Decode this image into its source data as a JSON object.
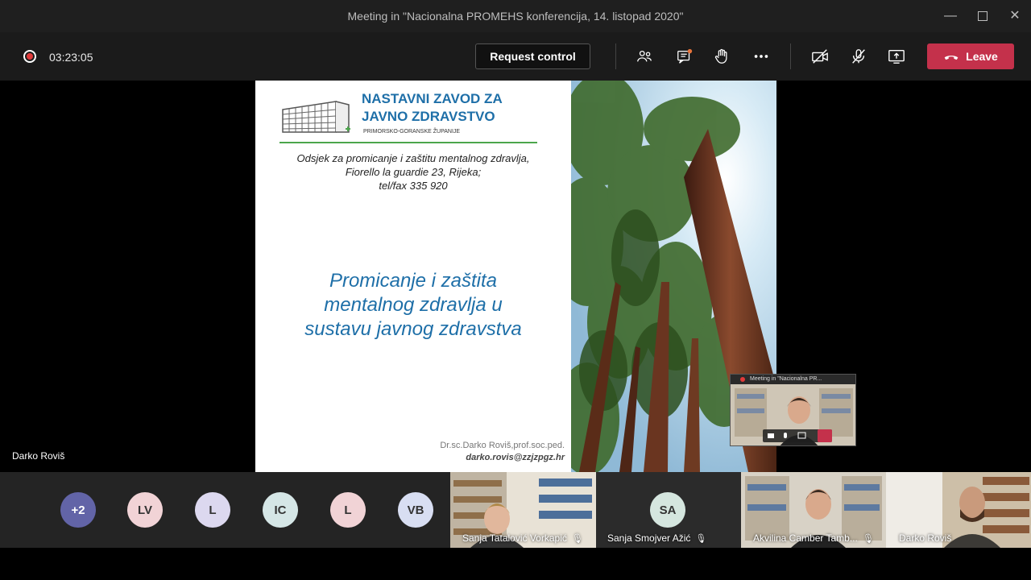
{
  "window": {
    "title": "Meeting in \"Nacionalna PROMEHS konferencija, 14. listopad 2020\""
  },
  "toolbar": {
    "timer": "03:23:05",
    "request_control_label": "Request control",
    "leave_label": "Leave",
    "icons": [
      "participants-icon",
      "chat-icon",
      "raise-hand-icon",
      "more-options-icon",
      "camera-off-icon",
      "mic-off-icon",
      "share-screen-icon"
    ]
  },
  "slide": {
    "org_line1": "NASTAVNI ZAVOD ZA",
    "org_line2": "JAVNO ZDRAVSTVO",
    "org_sub": "PRIMORSKO-GORANSKE ŽUPANIJE",
    "address_line1": "Odsjek za promicanje i zaštitu mentalnog zdravlja,",
    "address_line2": "Fiorello la guardie 23, Rijeka;",
    "address_line3": "tel/fax 335 920",
    "title_line1": "Promicanje i zaštita",
    "title_line2": "mentalnog zdravlja u",
    "title_line3": "sustavu javnog zdravstva",
    "author": "Dr.sc.Darko Roviš,prof.soc.ped.",
    "email": "darko.rovis@zzjzpgz.hr"
  },
  "mini_preview": {
    "title": "Meeting in \"Nacionalna PR..."
  },
  "presenter": {
    "name": "Darko Roviš"
  },
  "participants": {
    "avatars": [
      {
        "initials": "+2",
        "color": "#6264a7",
        "text_color": "#ffffff"
      },
      {
        "initials": "LV",
        "color": "#f1d3d6"
      },
      {
        "initials": "L",
        "color": "#dcd8ef"
      },
      {
        "initials": "IC",
        "color": "#d5e6e6"
      },
      {
        "initials": "L",
        "color": "#f1d3d6"
      },
      {
        "initials": "VB",
        "color": "#d8def2"
      }
    ],
    "video1_name": "Sanja Tatalović Vorkapić",
    "sa_initials": "SA",
    "sa_name": "Sanja Smojver Ažić",
    "video2_name": "Akvilina Camber Tamb...",
    "video3_name": "Darko Roviš"
  }
}
